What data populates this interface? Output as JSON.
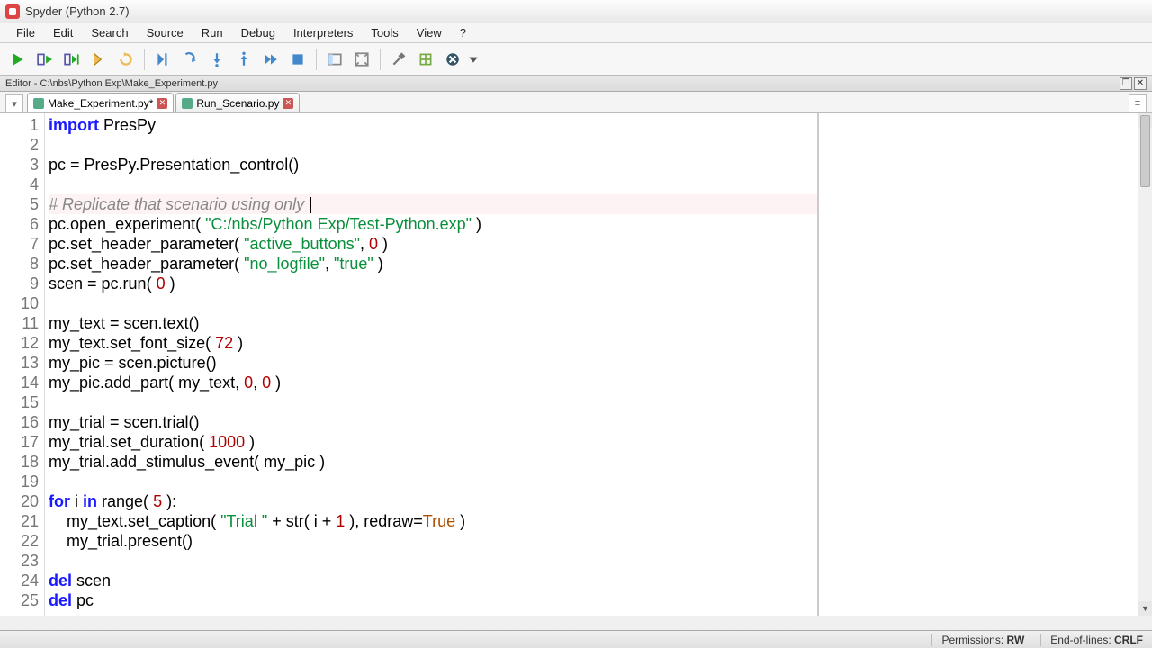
{
  "title": "Spyder (Python 2.7)",
  "menu": [
    "File",
    "Edit",
    "Search",
    "Source",
    "Run",
    "Debug",
    "Interpreters",
    "Tools",
    "View",
    "?"
  ],
  "panel_title": "Editor - C:\\nbs\\Python Exp\\Make_Experiment.py",
  "tabs": [
    {
      "label": "Make_Experiment.py*",
      "active": true
    },
    {
      "label": "Run_Scenario.py",
      "active": false
    }
  ],
  "code_lines": [
    {
      "n": 1,
      "seg": [
        [
          "kw",
          "import"
        ],
        [
          "nm",
          " PresPy"
        ]
      ]
    },
    {
      "n": 2,
      "seg": []
    },
    {
      "n": 3,
      "seg": [
        [
          "nm",
          "pc = PresPy.Presentation_control()"
        ]
      ]
    },
    {
      "n": 4,
      "seg": []
    },
    {
      "n": 5,
      "hl": true,
      "seg": [
        [
          "cm",
          "# Replicate that scenario using only "
        ]
      ],
      "cursor": true
    },
    {
      "n": 6,
      "seg": [
        [
          "nm",
          "pc.open_experiment( "
        ],
        [
          "str",
          "\"C:/nbs/Python Exp/Test-Python.exp\""
        ],
        [
          "nm",
          " )"
        ]
      ]
    },
    {
      "n": 7,
      "seg": [
        [
          "nm",
          "pc.set_header_parameter( "
        ],
        [
          "str",
          "\"active_buttons\""
        ],
        [
          "nm",
          ", "
        ],
        [
          "num",
          "0"
        ],
        [
          "nm",
          " )"
        ]
      ]
    },
    {
      "n": 8,
      "seg": [
        [
          "nm",
          "pc.set_header_parameter( "
        ],
        [
          "str",
          "\"no_logfile\""
        ],
        [
          "nm",
          ", "
        ],
        [
          "str",
          "\"true\""
        ],
        [
          "nm",
          " )"
        ]
      ]
    },
    {
      "n": 9,
      "seg": [
        [
          "nm",
          "scen = pc.run( "
        ],
        [
          "num",
          "0"
        ],
        [
          "nm",
          " )"
        ]
      ]
    },
    {
      "n": 10,
      "seg": []
    },
    {
      "n": 11,
      "seg": [
        [
          "nm",
          "my_text = scen.text()"
        ]
      ]
    },
    {
      "n": 12,
      "seg": [
        [
          "nm",
          "my_text.set_font_size( "
        ],
        [
          "num",
          "72"
        ],
        [
          "nm",
          " )"
        ]
      ]
    },
    {
      "n": 13,
      "seg": [
        [
          "nm",
          "my_pic = scen.picture()"
        ]
      ]
    },
    {
      "n": 14,
      "seg": [
        [
          "nm",
          "my_pic.add_part( my_text, "
        ],
        [
          "num",
          "0"
        ],
        [
          "nm",
          ", "
        ],
        [
          "num",
          "0"
        ],
        [
          "nm",
          " )"
        ]
      ]
    },
    {
      "n": 15,
      "seg": []
    },
    {
      "n": 16,
      "seg": [
        [
          "nm",
          "my_trial = scen.trial()"
        ]
      ]
    },
    {
      "n": 17,
      "seg": [
        [
          "nm",
          "my_trial.set_duration( "
        ],
        [
          "num",
          "1000"
        ],
        [
          "nm",
          " )"
        ]
      ]
    },
    {
      "n": 18,
      "seg": [
        [
          "nm",
          "my_trial.add_stimulus_event( my_pic )"
        ]
      ]
    },
    {
      "n": 19,
      "seg": []
    },
    {
      "n": 20,
      "seg": [
        [
          "kw",
          "for"
        ],
        [
          "nm",
          " i "
        ],
        [
          "kw",
          "in"
        ],
        [
          "nm",
          " range( "
        ],
        [
          "num",
          "5"
        ],
        [
          "nm",
          " ):"
        ]
      ]
    },
    {
      "n": 21,
      "seg": [
        [
          "nm",
          "    my_text.set_caption( "
        ],
        [
          "str",
          "\"Trial \""
        ],
        [
          "nm",
          " + str( i + "
        ],
        [
          "num",
          "1"
        ],
        [
          "nm",
          " ), redraw="
        ],
        [
          "bool",
          "True"
        ],
        [
          "nm",
          " )"
        ]
      ]
    },
    {
      "n": 22,
      "seg": [
        [
          "nm",
          "    my_trial.present()"
        ]
      ]
    },
    {
      "n": 23,
      "seg": []
    },
    {
      "n": 24,
      "seg": [
        [
          "kw",
          "del"
        ],
        [
          "nm",
          " scen"
        ]
      ]
    },
    {
      "n": 25,
      "seg": [
        [
          "kw",
          "del"
        ],
        [
          "nm",
          " pc"
        ]
      ]
    }
  ],
  "status": {
    "perm_label": "Permissions:",
    "perm_val": "RW",
    "eol_label": "End-of-lines:",
    "eol_val": "CRLF"
  }
}
